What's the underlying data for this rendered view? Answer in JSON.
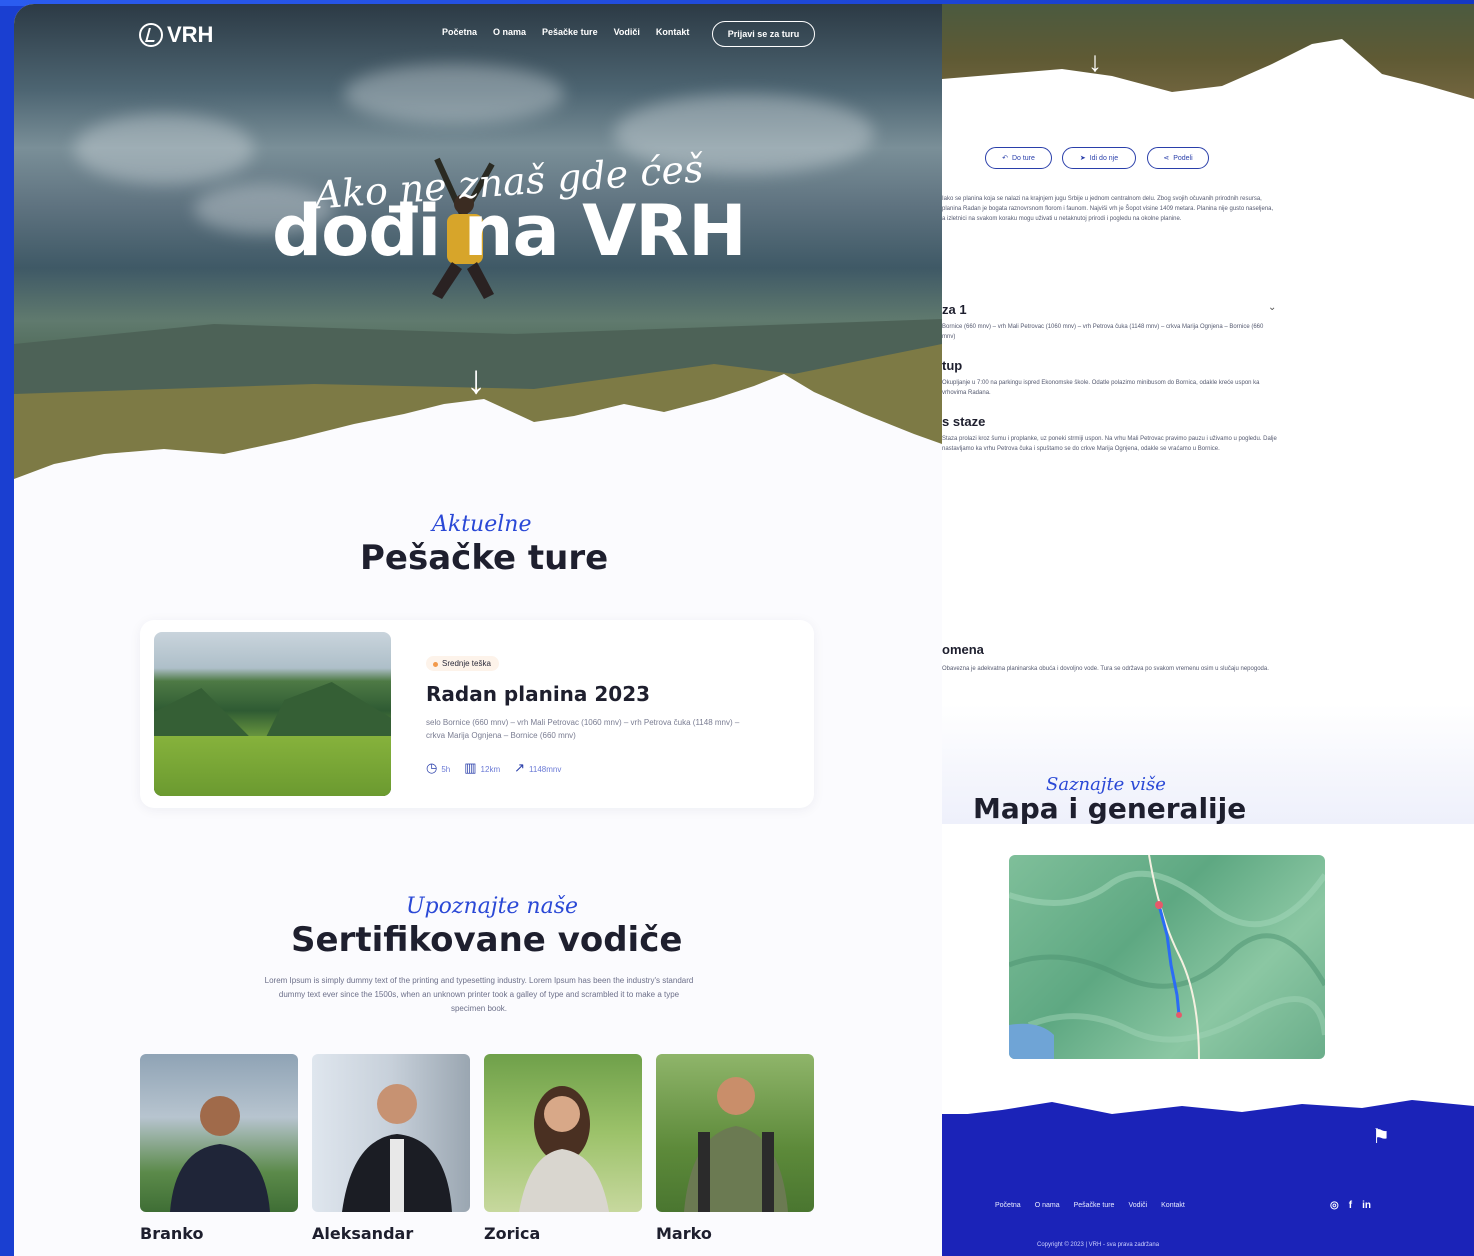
{
  "left_page": {
    "logo": "VRH",
    "nav": [
      "Početna",
      "O nama",
      "Pešačke ture",
      "Vodiči",
      "Kontakt"
    ],
    "nav_cta": "Prijavi se za turu",
    "hero_script": "Ako ne znaš gde ćeš",
    "hero_title": "dođi na VRH",
    "tours_script": "Aktuelne",
    "tours_title": "Pešačke ture",
    "tour": {
      "badge": "Srednje teška",
      "title": "Radan planina 2023",
      "description": "selo Bornice (660 mnv) – vrh Mali Petrovac (1060 mnv) – vrh Petrova čuka (1148 mnv) – crkva Marija Ognjena – Bornice (660 mnv)",
      "duration": "5h",
      "distance": "12km",
      "elevation": "1148mnv"
    },
    "guides_script": "Upoznajte naše",
    "guides_title": "Sertifikovane vodiče",
    "guides_lead": "Lorem Ipsum is simply dummy text of the printing and typesetting industry. Lorem Ipsum has been the industry's standard dummy text ever since the 1500s, when an unknown printer took a galley of type and scrambled it to make a type specimen book.",
    "guides": [
      "Branko",
      "Aleksandar",
      "Zorica",
      "Marko"
    ]
  },
  "right_page": {
    "actions": [
      "Do ture",
      "Idi do nje",
      "Podeli"
    ],
    "intro": "Iako se planina koja se nalazi na krajnjem jugu Srbije u jednom centralnom delu. Zbog svojih očuvanih prirodnih resursa, planina Radan je bogata raznovrsnom florom i faunom. Najviši vrh je Šopot visine 1409 metara. Planina nije gusto naseljena, a izletnici na svakom koraku mogu uživati u netaknutoj prirodi i pogledu na okolne planine.",
    "sections": [
      {
        "title": "za 1",
        "text": "Bornice (660 mnv) – vrh Mali Petrovac (1060 mnv) – vrh Petrova čuka (1148 mnv) – crkva Marija Ognjena – Bornice (660 mnv)"
      },
      {
        "title": "tup",
        "text": "Okupljanje u 7:00 na parkingu ispred Ekonomske škole. Odatle polazimo minibusom do Bornica, odakle kreće uspon ka vrhovima Radana."
      },
      {
        "title": "s staze",
        "text": "Staza prolazi kroz šumu i proplanke, uz poneki strmiji uspon. Na vrhu Mali Petrovac pravimo pauzu i uživamo u pogledu. Dalje nastavljamo ka vrhu Petrova čuka i spuštamo se do crkve Marija Ognjena, odakle se vraćamo u Bornice."
      },
      {
        "title": "omena",
        "text": "Obavezna je adekvatna planinarska obuća i dovoljno vode. Tura se održava po svakom vremenu osim u slučaju nepogoda."
      }
    ],
    "map_script": "Saznajte više",
    "map_title": "Mapa i generalije",
    "footer_nav": [
      "Početna",
      "O nama",
      "Pešačke ture",
      "Vodiči",
      "Kontakt"
    ],
    "social": [
      "instagram-icon",
      "facebook-icon",
      "linkedin-icon"
    ],
    "copyright": "Copyright © 2023 | VRH - sva prava zadržana"
  }
}
